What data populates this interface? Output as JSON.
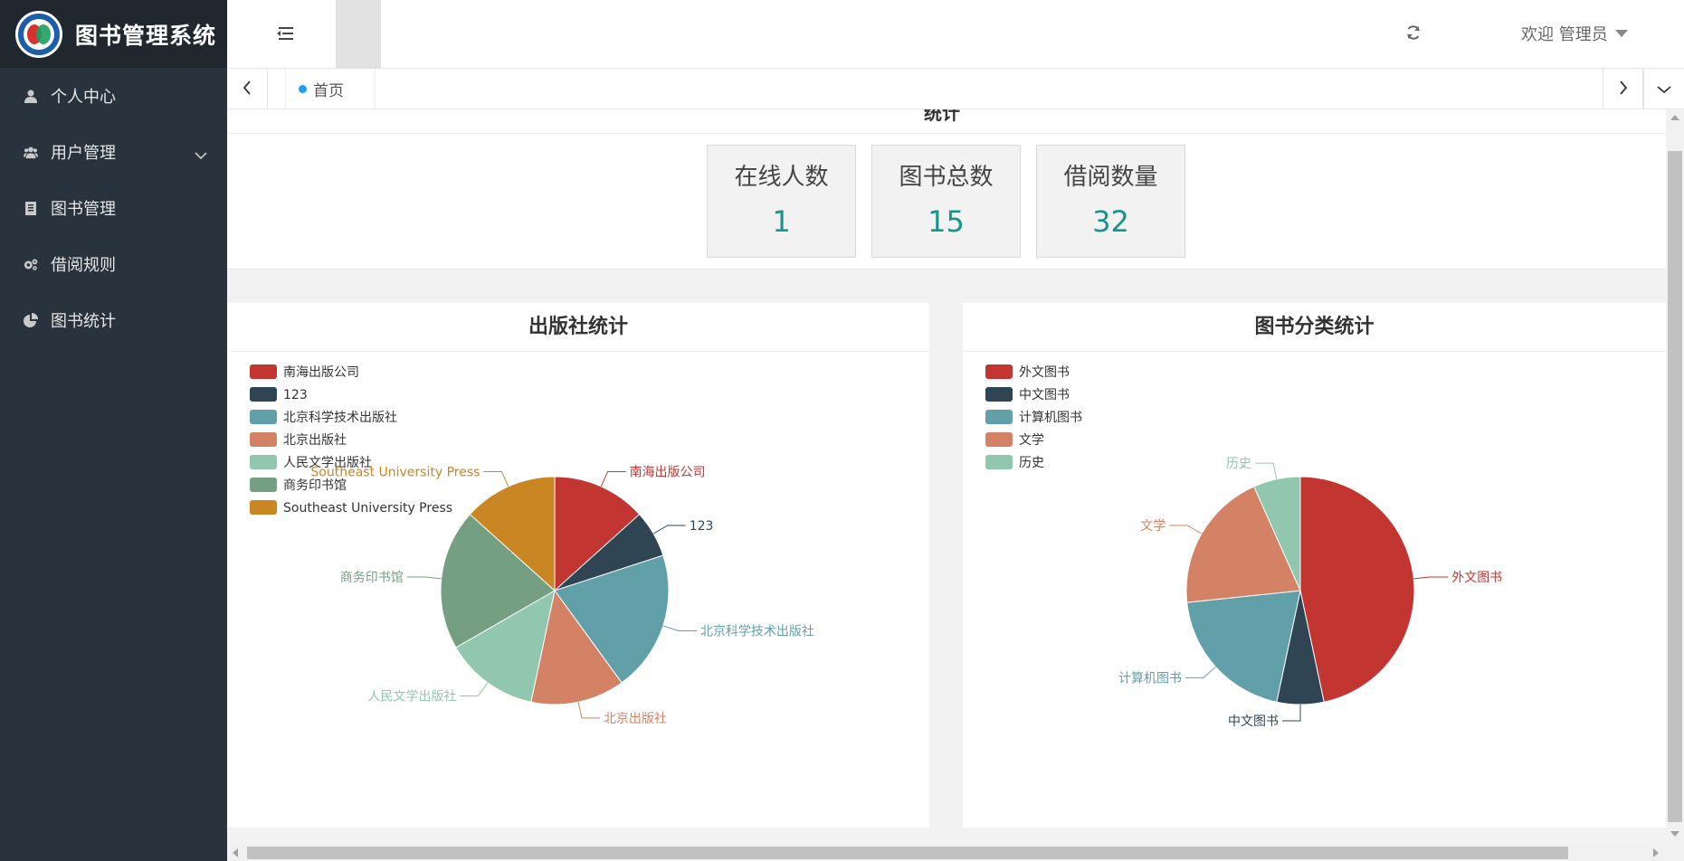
{
  "app": {
    "title": "图书管理系统"
  },
  "sidebar": {
    "items": [
      {
        "label": "个人中心",
        "icon": "user-icon"
      },
      {
        "label": "用户管理",
        "icon": "users-icon",
        "has_submenu": true
      },
      {
        "label": "图书管理",
        "icon": "book-icon"
      },
      {
        "label": "借阅规则",
        "icon": "gears-icon"
      },
      {
        "label": "图书统计",
        "icon": "pie-chart-icon"
      }
    ]
  },
  "header": {
    "welcome": "欢迎 管理员"
  },
  "tabs": [
    {
      "label": "首页",
      "active": true
    }
  ],
  "stats": {
    "section_title": "统计",
    "cards": [
      {
        "label": "在线人数",
        "value": "1"
      },
      {
        "label": "图书总数",
        "value": "15"
      },
      {
        "label": "借阅数量",
        "value": "32"
      }
    ]
  },
  "chart_data": [
    {
      "type": "pie",
      "title": "出版社统计",
      "legend_position": "top-left",
      "categories": [
        "南海出版公司",
        "123",
        "北京科学技术出版社",
        "北京出版社",
        "人民文学出版社",
        "商务印书馆",
        "Southeast University Press"
      ],
      "values": [
        2,
        1,
        3,
        2,
        2,
        3,
        2
      ],
      "colors": [
        "#c23531",
        "#2f4554",
        "#61a0a8",
        "#d48265",
        "#91c7ae",
        "#749f83",
        "#ca8622"
      ]
    },
    {
      "type": "pie",
      "title": "图书分类统计",
      "legend_position": "top-left",
      "categories": [
        "外文图书",
        "中文图书",
        "计算机图书",
        "文学",
        "历史"
      ],
      "values": [
        7,
        1,
        3,
        3,
        1
      ],
      "colors": [
        "#c23531",
        "#2f4554",
        "#61a0a8",
        "#d48265",
        "#91c7ae"
      ]
    }
  ]
}
